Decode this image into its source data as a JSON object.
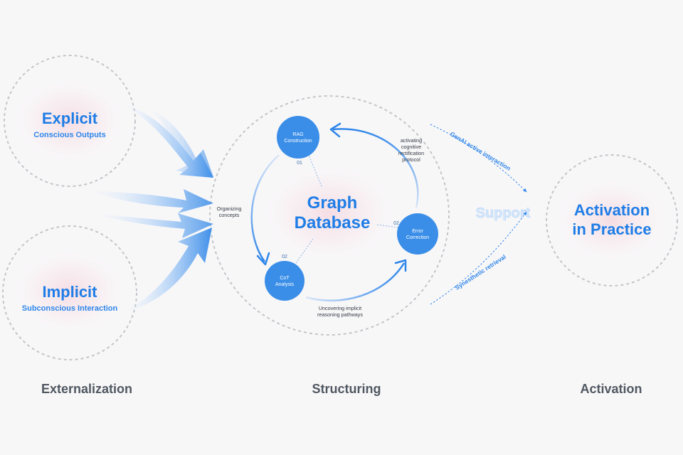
{
  "colors": {
    "accent": "#1f7de6",
    "node": "#3a8ee8",
    "ring": "#c3c5c9",
    "glow": "#f3c7d3",
    "stage_label": "#505861",
    "support_text": "#cfe3fb"
  },
  "externalization": {
    "explicit": {
      "title": "Explicit",
      "subtitle": "Conscious Outputs"
    },
    "implicit": {
      "title": "Implicit",
      "subtitle": "Subconscious Interaction"
    }
  },
  "structuring": {
    "center_line1": "Graph",
    "center_line2": "Database",
    "nodes": [
      {
        "line1": "RAG",
        "line2": "Construction",
        "number": "01"
      },
      {
        "line1": "CoT",
        "line2": "Analysis",
        "number": "02"
      },
      {
        "line1": "Error",
        "line2": "Correction",
        "number": "02"
      }
    ],
    "edges": {
      "left_line1": "Organizing",
      "left_line2": "concepts",
      "bottom_line1": "Uncovering implicit",
      "bottom_line2": "reasoning pathways",
      "right_line1": "activating",
      "right_line2": "cognitive",
      "right_line3": "rectification",
      "right_line4": "protocol"
    }
  },
  "support": {
    "label": "Support",
    "top_path": "GenAI active interaction",
    "bottom_path": "Synesthetic retrieval"
  },
  "activation": {
    "line1": "Activation",
    "line2": "in Practice"
  },
  "stages": {
    "left": "Externalization",
    "middle": "Structuring",
    "right": "Activation"
  }
}
